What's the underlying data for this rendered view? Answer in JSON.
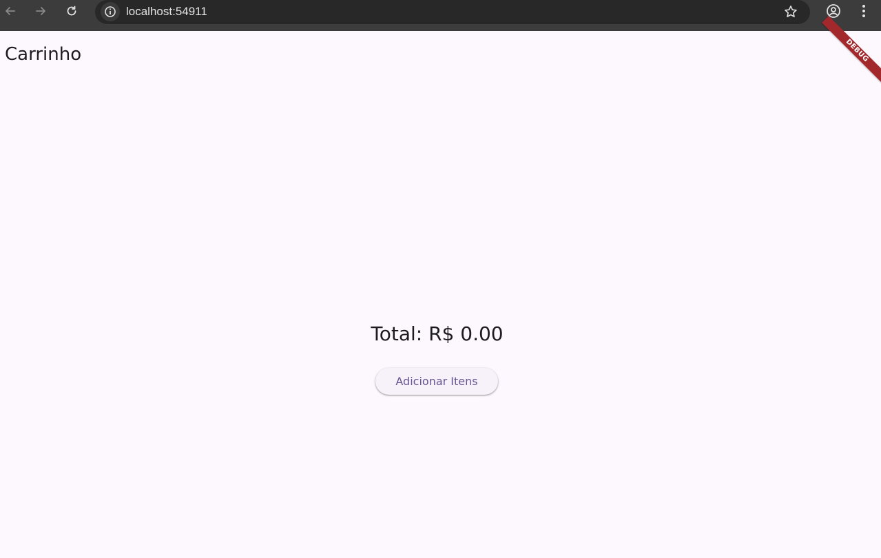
{
  "browser": {
    "url": "localhost:54911",
    "icons": {
      "back": "arrow-left-icon",
      "forward": "arrow-right-icon",
      "reload": "reload-icon",
      "site_info": "info-icon",
      "bookmark": "star-icon",
      "profile": "account-icon",
      "menu": "kebab-menu-icon"
    }
  },
  "app": {
    "title": "Carrinho",
    "debug_banner": "DEBUG",
    "total_text": "Total: R$ 0.00",
    "add_button_label": "Adicionar Itens"
  },
  "colors": {
    "background": "#fdf7fe",
    "chrome_bar": "#3c3c3c",
    "omnibox": "#282828",
    "button_bg": "#f7f2fa",
    "button_text": "#65558f",
    "debug_ribbon": "#a3282c",
    "text": "#1d1b20"
  }
}
